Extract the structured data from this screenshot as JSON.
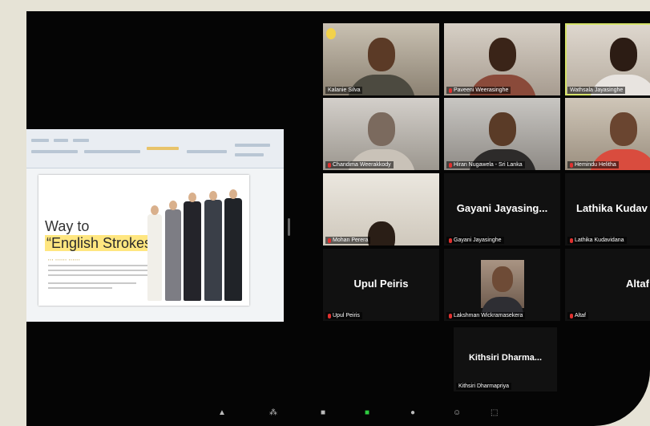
{
  "shared_screen": {
    "slide_title_line1": "Way to",
    "slide_title_line2": "“English Strokes”"
  },
  "participants": [
    {
      "name": "Kalanie Silva",
      "video": true,
      "talking": false,
      "muted": false
    },
    {
      "name": "Paveeni Weerasinghe",
      "video": true,
      "talking": false,
      "muted": true
    },
    {
      "name": "Wathsala Jayasinghe",
      "video": true,
      "talking": true,
      "muted": false
    },
    {
      "name": "Chandima Weerakkody",
      "video": true,
      "talking": false,
      "muted": true
    },
    {
      "name": "Hiran Nugawela - Sri Lanka",
      "video": true,
      "talking": false,
      "muted": true
    },
    {
      "name": "Hemindu Helitha",
      "video": true,
      "talking": false,
      "muted": true
    },
    {
      "name": "Mohan Perera",
      "video": true,
      "talking": false,
      "muted": true
    },
    {
      "name": "Gayani Jayasinghe",
      "display": "Gayani Jayasing...",
      "video": false,
      "talking": false,
      "muted": true
    },
    {
      "name": "Lathika Kudavidana",
      "display": "Lathika Kudav",
      "video": false,
      "talking": false,
      "muted": true
    },
    {
      "name": "Upul Peiris",
      "display": "Upul Peiris",
      "video": false,
      "talking": false,
      "muted": true
    },
    {
      "name": "Lakshman Wickramasekera",
      "video": true,
      "talking": false,
      "muted": true
    },
    {
      "name": "Altaf",
      "display": "Altaf",
      "video": false,
      "talking": false,
      "muted": true
    },
    {
      "name": "Kithsiri Dharmapriya",
      "display": "Kithsiri Dharma...",
      "video": false,
      "talking": false,
      "muted": false
    }
  ],
  "colors": {
    "talking_border": "#d6e36a",
    "muted_icon": "#e0312f",
    "background": "#050505"
  },
  "icons": [
    "mic-muted-icon",
    "security-icon",
    "participants-icon",
    "chat-icon",
    "share-screen-icon",
    "record-icon",
    "reactions-icon"
  ]
}
